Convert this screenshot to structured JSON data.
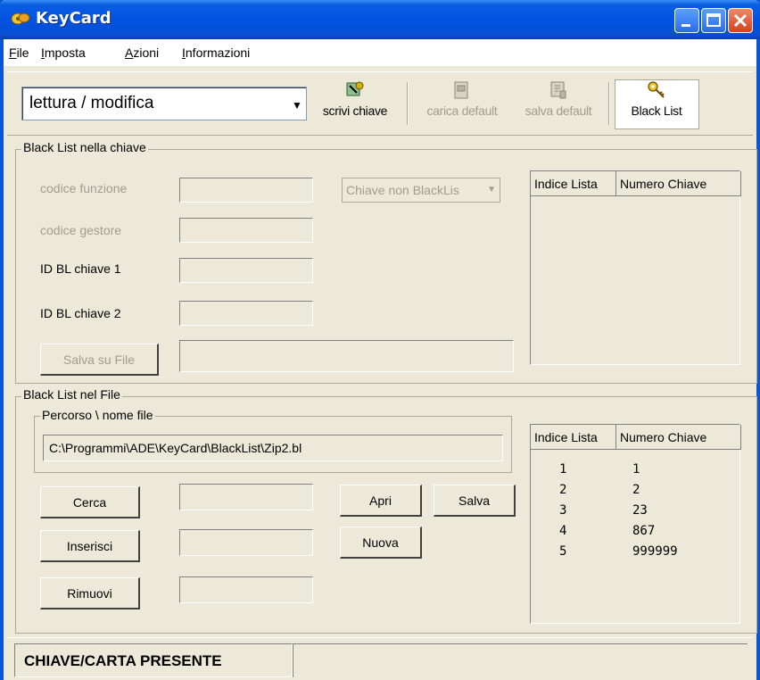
{
  "window": {
    "title": "KeyCard"
  },
  "menu": {
    "items": [
      {
        "label": "File",
        "accel": "F",
        "rest": "ile"
      },
      {
        "label": "Imposta",
        "accel": "I",
        "rest": "mposta"
      },
      {
        "label": "Azioni",
        "accel": "A",
        "rest": "zioni"
      },
      {
        "label": "Informazioni",
        "accel": "I",
        "rest": "nformazioni"
      }
    ]
  },
  "toolbar": {
    "mode_value": "lettura / modifica",
    "scrivi_chiave": "scrivi chiave",
    "carica_default": "carica default",
    "salva_default": "salva default",
    "black_list": "Black List"
  },
  "chiave_group": {
    "title": "Black List nella chiave",
    "codice_funzione": "codice funzione",
    "codice_gestore": "codice gestore",
    "id_bl_1": "ID BL chiave 1",
    "id_bl_2": "ID BL chiave 2",
    "combo_value": "Chiave non BlackLis",
    "salva_su_file": "Salva su File",
    "list_headers": [
      "Indice Lista",
      "Numero Chiave"
    ]
  },
  "file_group": {
    "title": "Black List nel File",
    "path_title": "Percorso \\ nome file",
    "path_value": "C:\\Programmi\\ADE\\KeyCard\\BlackList\\Zip2.bl",
    "cerca": "Cerca",
    "inserisci": "Inserisci",
    "rimuovi": "Rimuovi",
    "apri": "Apri",
    "salva": "Salva",
    "nuova": "Nuova",
    "list_headers": [
      "Indice Lista",
      "Numero Chiave"
    ],
    "rows": [
      {
        "indice": "1",
        "numero": "1"
      },
      {
        "indice": "2",
        "numero": "2"
      },
      {
        "indice": "3",
        "numero": "23"
      },
      {
        "indice": "4",
        "numero": "867"
      },
      {
        "indice": "5",
        "numero": "999999"
      }
    ]
  },
  "status": {
    "text": "CHIAVE/CARTA PRESENTE"
  },
  "colors": {
    "titlebar": "#0054e3",
    "face": "#ece9d8",
    "disabled_text": "#a09d8e"
  },
  "icons": [
    "keycard-app-icon",
    "minimize-icon",
    "maximize-icon",
    "close-icon",
    "write-key-icon",
    "load-default-icon",
    "save-default-icon",
    "key-icon",
    "dropdown-arrow-icon"
  ]
}
